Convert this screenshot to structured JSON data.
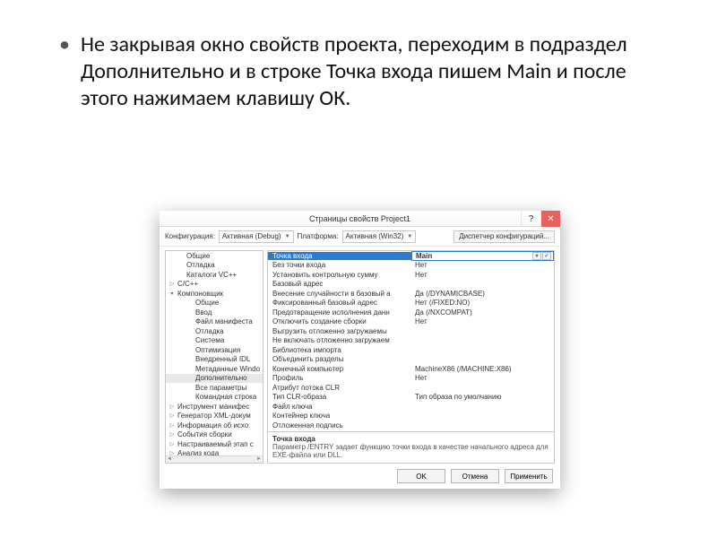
{
  "bullet_text": "Не закрывая окно свойств проекта, переходим в подраздел Дополнительно и в строке Точка входа пишем Main и после этого нажимаем клавишу ОК.",
  "dialog": {
    "title": "Страницы свойств Project1",
    "config_label": "Конфигурация:",
    "config_value": "Активная (Debug)",
    "platform_label": "Платформа:",
    "platform_value": "Активная (Win32)",
    "config_manager": "Диспетчер конфигураций...",
    "tree": [
      {
        "label": "Общие",
        "lvl": 1
      },
      {
        "label": "Отладка",
        "lvl": 1
      },
      {
        "label": "Каталоги VC++",
        "lvl": 1
      },
      {
        "label": "C/C++",
        "lvl": 0,
        "tw": "▷"
      },
      {
        "label": "Компоновщик",
        "lvl": 0,
        "tw": "▾"
      },
      {
        "label": "Общие",
        "lvl": 2
      },
      {
        "label": "Ввод",
        "lvl": 2
      },
      {
        "label": "Файл манифеста",
        "lvl": 2
      },
      {
        "label": "Отладка",
        "lvl": 2
      },
      {
        "label": "Система",
        "lvl": 2
      },
      {
        "label": "Оптимизация",
        "lvl": 2
      },
      {
        "label": "Внедренный IDL",
        "lvl": 2
      },
      {
        "label": "Метаданные Windo",
        "lvl": 2
      },
      {
        "label": "Дополнительно",
        "lvl": 2,
        "sel": true
      },
      {
        "label": "Все параметры",
        "lvl": 2
      },
      {
        "label": "Командная строка",
        "lvl": 2
      },
      {
        "label": "Инструмент манифес",
        "lvl": 0,
        "tw": "▷"
      },
      {
        "label": "Генератор XML-докум",
        "lvl": 0,
        "tw": "▷"
      },
      {
        "label": "Информация об исхо",
        "lvl": 0,
        "tw": "▷"
      },
      {
        "label": "События сборки",
        "lvl": 0,
        "tw": "▷"
      },
      {
        "label": "Настраиваемый этап с",
        "lvl": 0,
        "tw": "▷"
      },
      {
        "label": "Анализ кода",
        "lvl": 0,
        "tw": "▷"
      }
    ],
    "grid": [
      {
        "name": "Точка входа",
        "val": "Main",
        "sel": true
      },
      {
        "name": "Без точки входа",
        "val": "Нет"
      },
      {
        "name": "Установить контрольную сумму",
        "val": "Нет"
      },
      {
        "name": "Базовый адрес",
        "val": ""
      },
      {
        "name": "Внесение случайности в базовый а",
        "val": "Да (/DYNAMICBASE)"
      },
      {
        "name": "Фиксированный базовый адрес",
        "val": "Нет (/FIXED:NO)"
      },
      {
        "name": "Предотвращение исполнения данн",
        "val": "Да (/NXCOMPAT)"
      },
      {
        "name": "Отключить создание сборки",
        "val": "Нет"
      },
      {
        "name": "Выгрузить отложенно загружаемы",
        "val": ""
      },
      {
        "name": "Не включать отложенно загружаем",
        "val": ""
      },
      {
        "name": "Библиотека импорта",
        "val": ""
      },
      {
        "name": "Объединить разделы",
        "val": ""
      },
      {
        "name": "Конечный компьютер",
        "val": "MachineX86 (/MACHINE:X86)"
      },
      {
        "name": "Профиль",
        "val": "Нет"
      },
      {
        "name": "Атрибут потока CLR",
        "val": ""
      },
      {
        "name": "Тип CLR-образа",
        "val": "Тип образа по умолчанию"
      },
      {
        "name": "Файл ключа",
        "val": ""
      },
      {
        "name": "Контейнер ключа",
        "val": ""
      },
      {
        "name": "Отложенная подпись",
        "val": ""
      }
    ],
    "desc_head": "Точка входа",
    "desc_body": "Параметр /ENTRY задает функцию точки входа в качестве начального адреса для EXE-файла или DLL.",
    "buttons": {
      "ok": "OK",
      "cancel": "Отмена",
      "apply": "Применить"
    }
  }
}
